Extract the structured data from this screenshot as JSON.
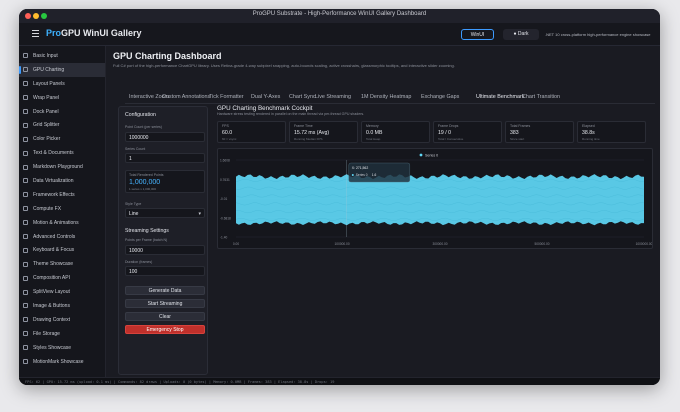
{
  "window": {
    "title": "ProGPU Substrate - High-Performance WinUI Gallery Dashboard",
    "traffic_colors": [
      "#ff5f57",
      "#febc2e",
      "#28c840"
    ]
  },
  "appbar": {
    "brand_prefix": "Pro",
    "brand_rest": "GPU WinUI Gallery",
    "winui_label": "WinUI",
    "dark_label": "Dark",
    "info": ".NET 10 cross-platform high-performance engine showcase"
  },
  "sidebar": {
    "items": [
      {
        "label": "Basic Input",
        "icon": "input-icon",
        "active": false
      },
      {
        "label": "GPU Charting",
        "icon": "chart-icon",
        "active": true
      },
      {
        "label": "Layout Panels",
        "icon": "layout-icon",
        "active": false
      },
      {
        "label": "Wrap Panel",
        "icon": "wrap-icon",
        "active": false
      },
      {
        "label": "Dock Panel",
        "icon": "dock-icon",
        "active": false
      },
      {
        "label": "Grid Splitter",
        "icon": "grid-icon",
        "active": false
      },
      {
        "label": "Color Picker",
        "icon": "palette-icon",
        "active": false
      },
      {
        "label": "Text & Documents",
        "icon": "text-icon",
        "active": false
      },
      {
        "label": "Markdown Playground",
        "icon": "markdown-icon",
        "active": false
      },
      {
        "label": "Data Virtualization",
        "icon": "data-icon",
        "active": false
      },
      {
        "label": "Framework Effects",
        "icon": "effects-icon",
        "active": false
      },
      {
        "label": "Compute FX",
        "icon": "compute-icon",
        "active": false
      },
      {
        "label": "Motion & Animations",
        "icon": "motion-icon",
        "active": false
      },
      {
        "label": "Advanced Controls",
        "icon": "controls-icon",
        "active": false
      },
      {
        "label": "Keyboard & Focus",
        "icon": "keyboard-icon",
        "active": false
      },
      {
        "label": "Theme Showcase",
        "icon": "theme-icon",
        "active": false
      },
      {
        "label": "Composition API",
        "icon": "composition-icon",
        "active": false
      },
      {
        "label": "SplitView Layout",
        "icon": "splitview-icon",
        "active": false
      },
      {
        "label": "Image & Buttons",
        "icon": "image-icon",
        "active": false
      },
      {
        "label": "Drawing Context",
        "icon": "drawing-icon",
        "active": false
      },
      {
        "label": "File Storage",
        "icon": "file-icon",
        "active": false
      },
      {
        "label": "Styles Showcase",
        "icon": "styles-icon",
        "active": false
      },
      {
        "label": "MotionMark Showcase",
        "icon": "motionmark-icon",
        "active": false
      }
    ]
  },
  "page": {
    "title": "GPU Charting Dashboard",
    "subtitle": "Full C# port of the high-performance ChartGPU library. Uses Retina-grade 4-way subpixel snapping, auto-bounds scaling, active crosshairs, glassmorphic tooltips, and interactive slider zooming."
  },
  "tabs": [
    "Interactive Zoom",
    "Custom Annotations",
    "Tick Formatter",
    "Dual Y-Axes",
    "Chart Sync",
    "Live Streaming",
    "1M Density Heatmap",
    "Exchange Gaps",
    "Ultimate Benchmark",
    "Chart Transition"
  ],
  "active_tab": "Ultimate Benchmark",
  "config": {
    "title": "Configuration",
    "point_count_label": "Point Count (per series)",
    "point_count": "1000000",
    "series_count_label": "Series Count",
    "series_count": "1",
    "total_points_label": "Total Rendered Points",
    "total_points": "1,000,000",
    "total_points_sub": "1 series x 1,000,000",
    "style_label": "Style Type",
    "style": "Line",
    "streaming_title": "Streaming Settings",
    "points_per_frame_label": "Points per Frame (batch N)",
    "points_per_frame": "10000",
    "duration_label": "Duration (frames)",
    "duration": "100",
    "buttons": {
      "generate": "Generate Data",
      "start": "Start Streaming",
      "clear": "Clear",
      "emergency": "Emergency Stop"
    }
  },
  "cockpit": {
    "title": "GPU Charting Benchmark Cockpit",
    "subtitle": "Hardware stress testing rendered in parallel on the main thread via per-thread GPU shaders.",
    "stats": [
      {
        "label": "FPS",
        "value": "60.0",
        "sub": "60 = vsync"
      },
      {
        "label": "Frame Time",
        "value": "15.72 ms (Avg)",
        "sub": "Running Median FPS"
      },
      {
        "label": "Memory",
        "value": "0.0 MB",
        "sub": "Total Heap"
      },
      {
        "label": "Frame Drops",
        "value": "19 / 0",
        "sub": "Total / Consecutive"
      },
      {
        "label": "Total Frames",
        "value": "383",
        "sub": "Since start"
      },
      {
        "label": "Elapsed",
        "value": "38.8s",
        "sub": "Running time"
      }
    ]
  },
  "chart_data": {
    "type": "line",
    "legend": "Series 0",
    "tooltip": {
      "header": "X: 271,562",
      "series": "Series 0",
      "value": "1.6"
    },
    "x_ticks": [
      "0.00",
      "100000.00",
      "300000.00",
      "500000.00",
      "1000000.00"
    ],
    "y_ticks": [
      "1.6608",
      "0.7631",
      "-0.01",
      "-0.6818",
      "-1.40"
    ],
    "xlim": [
      0,
      1000000
    ],
    "ylim": [
      -1.4,
      1.6608
    ],
    "series_color": "#5fd8f6",
    "series": [
      {
        "name": "Series 0",
        "envelope_upper": 1.0,
        "envelope_lower": -0.85
      }
    ]
  },
  "footer": {
    "text": "FPS: 62 | GPU: 15.72 ms (upload: 0.1 ms) | Commands: 82 draws | Uploads: 0 (0 bytes) | Memory: 0.0MB | Frames: 383 | Elapsed: 38.8s | Drops: 19"
  }
}
